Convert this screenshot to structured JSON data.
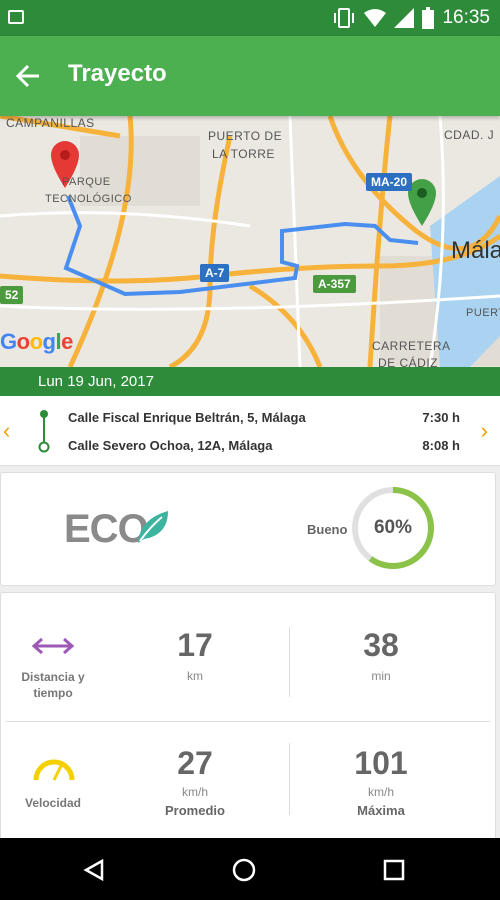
{
  "status": {
    "time": "16:35"
  },
  "app": {
    "title": "Trayecto"
  },
  "map": {
    "labels": {
      "campanillas": "CAMPANILLAS",
      "puerto1": "PUERTO DE",
      "puerto2": "LA TORRE",
      "cdad": "CDAD. J",
      "parque1": "PARQUE",
      "parque2": "TECNOLÓGICO",
      "malaga": "Mála",
      "puert": "PUERT",
      "carretera1": "CARRETERA",
      "carretera2": "DE CÁDIZ"
    },
    "shields": {
      "ma20": "MA-20",
      "a7": "A-7",
      "a357": "A-357",
      "n52": "52"
    },
    "colors": {
      "road": "#f7b23b",
      "route": "#4a8ef0",
      "start_pin": "#e53935",
      "end_pin": "#43a047",
      "highway_shield": "#2d6fc0",
      "green_shield": "#4b9a3d"
    },
    "google": {
      "G": "G",
      "o1": "o",
      "o2": "o",
      "g": "g",
      "l": "l",
      "e": "e"
    }
  },
  "date": "Lun 19 Jun, 2017",
  "route": {
    "origin": {
      "address": "Calle Fiscal Enrique Beltrán, 5, Málaga",
      "time": "7:30 h"
    },
    "destination": {
      "address": "Calle Severo Ochoa, 12A, Málaga",
      "time": "8:08 h"
    },
    "prev_icon": "chevron-left-icon",
    "next_icon": "chevron-right-icon"
  },
  "eco": {
    "logo": "ECO",
    "rating_label": "Bueno",
    "percent_text": "60%",
    "percent": 0.6,
    "ring_color": "#8bc34a"
  },
  "stats": {
    "distance": {
      "label": "Distancia y tiempo",
      "km_value": "17",
      "km_unit": "km",
      "min_value": "38",
      "min_unit": "min",
      "icon": "arrows-horizontal-icon",
      "icon_color": "#9c59b6"
    },
    "speed": {
      "label": "Velocidad",
      "avg_value": "27",
      "avg_unit": "km/h",
      "avg_label": "Promedio",
      "max_value": "101",
      "max_unit": "km/h",
      "max_label": "Máxima",
      "icon": "speedometer-icon",
      "icon_color": "#f4d000"
    }
  },
  "navbar": {
    "back": "back-triangle-icon",
    "home": "home-circle-icon",
    "recents": "recents-square-icon"
  }
}
